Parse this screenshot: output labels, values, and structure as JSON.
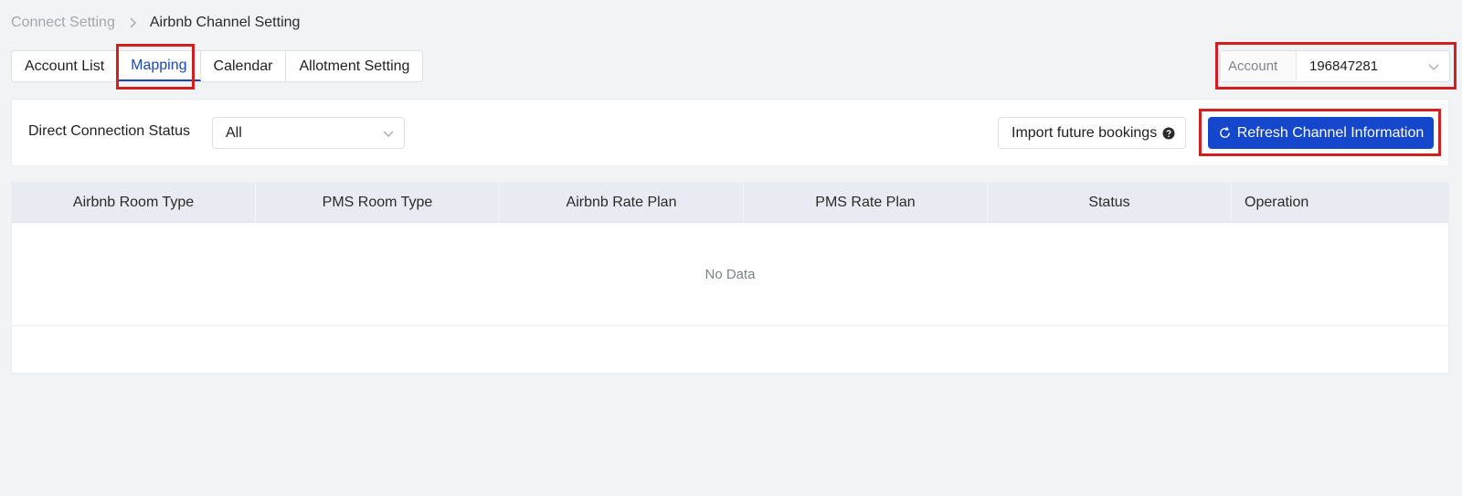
{
  "breadcrumb": {
    "parent": "Connect Setting",
    "current": "Airbnb Channel Setting"
  },
  "tabs": [
    {
      "label": "Account List"
    },
    {
      "label": "Mapping"
    },
    {
      "label": "Calendar"
    },
    {
      "label": "Allotment Setting"
    }
  ],
  "account": {
    "label": "Account",
    "value": "196847281"
  },
  "filter": {
    "status_label": "Direct Connection Status",
    "status_value": "All",
    "import_label": "Import future bookings",
    "refresh_label": "Refresh Channel Information"
  },
  "table": {
    "columns": [
      "Airbnb Room Type",
      "PMS Room Type",
      "Airbnb Rate Plan",
      "PMS Rate Plan",
      "Status",
      "Operation"
    ],
    "empty_text": "No Data"
  },
  "colors": {
    "accent": "#1447cc",
    "active_tab": "#1a49b5",
    "highlight": "#d21f1f"
  },
  "icons": [
    "chevron-right-icon",
    "chevron-down-icon",
    "question-circle-icon",
    "refresh-icon"
  ]
}
